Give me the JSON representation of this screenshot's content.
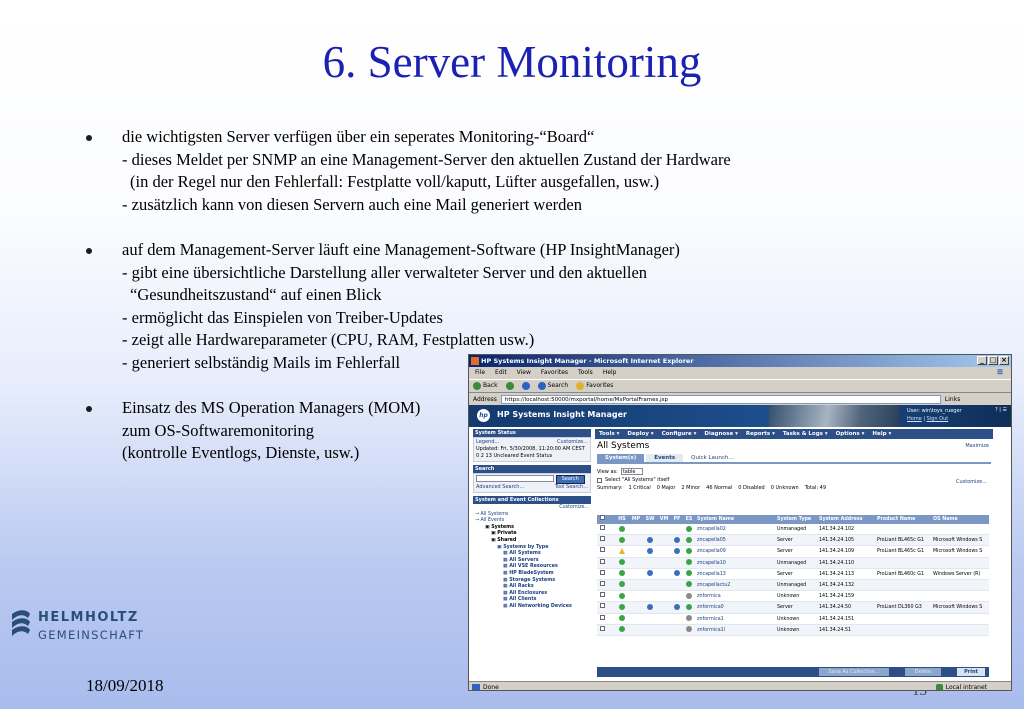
{
  "slide": {
    "title": "6. Server Monitoring",
    "bullets": [
      {
        "lines": [
          "die wichtigsten Server verfügen über ein seperates Monitoring-“Board“",
          "- dieses Meldet per SNMP an eine Management-Server den aktuellen Zustand der Hardware",
          "(in der Regel nur den Fehlerfall: Festplatte voll/kaputt, Lüfter ausgefallen, usw.)",
          "- zusätzlich kann von diesen Servern auch eine Mail generiert werden"
        ]
      },
      {
        "lines": [
          "auf dem Management-Server läuft eine Management-Software (HP InsightManager)",
          "- gibt eine übersichtliche Darstellung aller verwalteter Server und den aktuellen",
          "“Gesundheitszustand“ auf einen Blick",
          "- ermöglicht das Einspielen von Treiber-Updates",
          "- zeigt alle Hardwareparameter (CPU, RAM, Festplatten usw.)",
          "- generiert selbständig Mails im Fehlerfall"
        ]
      },
      {
        "lines": [
          "Einsatz des MS Operation Managers (MOM)",
          "zum OS-Softwaremonitoring",
          "(kontrolle Eventlogs, Dienste, usw.)"
        ]
      }
    ],
    "logo": {
      "line1": "HELMHOLTZ",
      "line2": "GEMEINSCHAFT"
    },
    "date": "18/09/2018",
    "page_number": "15"
  },
  "browser": {
    "window_title": "HP Systems Insight Manager - Microsoft Internet Explorer",
    "menu": [
      "File",
      "Edit",
      "View",
      "Favorites",
      "Tools",
      "Help"
    ],
    "toolbar": [
      "Back",
      "Search",
      "Favorites"
    ],
    "address_label": "Address",
    "address": "https://localhost:50000/mxportal/home/MxPortalFrames.jsp",
    "links_label": "Links",
    "status_left": "Done",
    "status_right": "Local intranet"
  },
  "sim": {
    "product": "HP Systems Insight Manager",
    "user_line": "User: win\\toys_rueger",
    "home": "Home",
    "sign_out": "Sign Out",
    "banner_links": "? | ☰",
    "left": {
      "status_title": "System Status",
      "legend": "Legend...",
      "customize": "Customize...",
      "updated": "Updated: Fri, 5/30/2008, 11:20:00 AM CEST",
      "counts": "0   2   13  Uncleared Event Status",
      "search_title": "Search",
      "search_btn": "Search",
      "adv_search": "Advanced Search...",
      "tool_search": "Tool Search...",
      "coll_title": "System and Event Collections",
      "coll_customize": "Customize...",
      "tree": [
        {
          "level": 0,
          "label": "All Systems"
        },
        {
          "level": 0,
          "label": "All Events"
        },
        {
          "level": 1,
          "label": "Systems"
        },
        {
          "level": 2,
          "label": "Private"
        },
        {
          "level": 2,
          "label": "Shared"
        },
        {
          "level": 3,
          "label": "Systems by Type"
        },
        {
          "level": 4,
          "label": "All Systems"
        },
        {
          "level": 4,
          "label": "All Servers"
        },
        {
          "level": 4,
          "label": "All VSE Resources"
        },
        {
          "level": 4,
          "label": "HP BladeSystem"
        },
        {
          "level": 4,
          "label": "Storage Systems"
        },
        {
          "level": 4,
          "label": "All Racks"
        },
        {
          "level": 4,
          "label": "All Enclosures"
        },
        {
          "level": 4,
          "label": "All Clients"
        },
        {
          "level": 4,
          "label": "All Networking Devices"
        }
      ]
    },
    "nav": [
      "Tools ▾",
      "Deploy ▾",
      "Configure ▾",
      "Diagnose ▾",
      "Reports ▾",
      "Tasks & Logs ▾",
      "Options ▾",
      "Help ▾"
    ],
    "page_title": "All Systems",
    "maximize": "Maximize",
    "tabs": [
      "System(s)",
      "Events"
    ],
    "quick_launch": "Quick Launch...",
    "view_as_label": "View as:",
    "view_as_value": "table",
    "customize": "Customize...",
    "select_all": "Select \"All Systems\" itself",
    "summary": [
      "Summary:",
      "1 Critical",
      "0 Major",
      "2 Minor",
      "46 Normal",
      "0 Disabled",
      "0 Unknown",
      "Total: 49"
    ],
    "columns": [
      "",
      "HS",
      "MP",
      "SW",
      "VM",
      "PF",
      "ES",
      "System Name",
      "System Type",
      "System Address",
      "Product Name",
      "OS Name"
    ],
    "rows": [
      {
        "hs": "ok",
        "mp": "",
        "sw": "",
        "vm": "",
        "pf": "",
        "es": "ok",
        "name": "zncapella02",
        "type": "Unmanaged",
        "addr": "141.34.24.102",
        "product": "",
        "os": ""
      },
      {
        "hs": "ok",
        "mp": "",
        "sw": "info",
        "vm": "",
        "pf": "info",
        "es": "ok",
        "name": "zncapella05",
        "type": "Server",
        "addr": "141.34.24.105",
        "product": "ProLiant BL465c G1",
        "os": "Microsoft Windows S"
      },
      {
        "hs": "warn",
        "mp": "",
        "sw": "info",
        "vm": "",
        "pf": "info",
        "es": "ok",
        "name": "zncapella09",
        "type": "Server",
        "addr": "141.34.24.109",
        "product": "ProLiant BL465c G1",
        "os": "Microsoft Windows S"
      },
      {
        "hs": "ok",
        "mp": "",
        "sw": "",
        "vm": "",
        "pf": "",
        "es": "ok",
        "name": "zncapella10",
        "type": "Unmanaged",
        "addr": "141.34.24.110",
        "product": "",
        "os": ""
      },
      {
        "hs": "ok",
        "mp": "",
        "sw": "info",
        "vm": "",
        "pf": "info",
        "es": "ok",
        "name": "zncapella13",
        "type": "Server",
        "addr": "141.34.24.113",
        "product": "ProLiant BL460c G1",
        "os": "Windows Server (R)"
      },
      {
        "hs": "ok",
        "mp": "",
        "sw": "",
        "vm": "",
        "pf": "",
        "es": "ok",
        "name": "zncapellactu2",
        "type": "Unmanaged",
        "addr": "141.34.24.132",
        "product": "",
        "os": ""
      },
      {
        "hs": "ok",
        "mp": "",
        "sw": "",
        "vm": "",
        "pf": "",
        "es": "unk",
        "name": "znformica",
        "type": "Unknown",
        "addr": "141.34.24.159",
        "product": "",
        "os": ""
      },
      {
        "hs": "ok",
        "mp": "",
        "sw": "info",
        "vm": "",
        "pf": "info",
        "es": "ok",
        "name": "znformica0",
        "type": "Server",
        "addr": "141.34.24.50",
        "product": "ProLiant DL360 G3",
        "os": "Microsoft Windows S"
      },
      {
        "hs": "ok",
        "mp": "",
        "sw": "",
        "vm": "",
        "pf": "",
        "es": "unk",
        "name": "znformica1",
        "type": "Unknown",
        "addr": "141.34.24.151",
        "product": "",
        "os": ""
      },
      {
        "hs": "ok",
        "mp": "",
        "sw": "",
        "vm": "",
        "pf": "",
        "es": "unk",
        "name": "znformica1l",
        "type": "Unknown",
        "addr": "141.34.24.51",
        "product": "",
        "os": ""
      }
    ],
    "buttons": [
      "Save As Collection...",
      "Delete",
      "Print"
    ]
  }
}
